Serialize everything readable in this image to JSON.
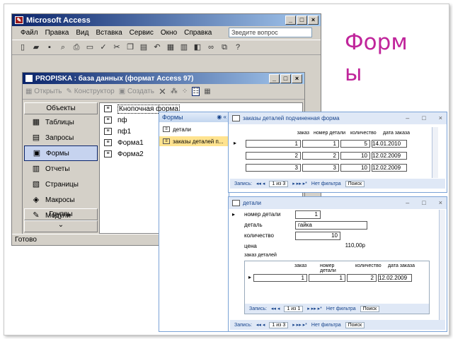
{
  "slide": {
    "title": "Формы"
  },
  "access": {
    "title": "Microsoft Access",
    "menu": [
      "Файл",
      "Правка",
      "Вид",
      "Вставка",
      "Сервис",
      "Окно",
      "Справка"
    ],
    "ask_placeholder": "Зведите вопрос",
    "status": "Готово"
  },
  "dbwin": {
    "title": "PROPISKA : база данных (формат Access 97)",
    "toolbar": {
      "open": "Открыть",
      "design": "Конструктор",
      "create": "Создать"
    },
    "objects_header": "Объекты",
    "objects": [
      {
        "icon": "▦",
        "label": "Таблицы",
        "selected": false
      },
      {
        "icon": "▤",
        "label": "Запросы",
        "selected": false
      },
      {
        "icon": "▣",
        "label": "Формы",
        "selected": true
      },
      {
        "icon": "▥",
        "label": "Отчеты",
        "selected": false
      },
      {
        "icon": "▧",
        "label": "Страницы",
        "selected": false
      },
      {
        "icon": "◈",
        "label": "Макросы",
        "selected": false
      },
      {
        "icon": "✎",
        "label": "Модули",
        "selected": false
      }
    ],
    "groups": "Группы",
    "forms": [
      "Кнопочная форма",
      "пф",
      "пф1",
      "Форма1",
      "Форма2"
    ]
  },
  "nav": {
    "header": "Формы",
    "items": [
      "детали",
      "заказы деталей п..."
    ]
  },
  "form1": {
    "title": "заказы деталей подчиненная форма",
    "columns": [
      "заказ",
      "номер детали",
      "количество",
      "дата заказа"
    ],
    "rows": [
      [
        "1",
        "1",
        "5",
        "14.01.2010"
      ],
      [
        "2",
        "2",
        "10",
        "12.02.2009"
      ],
      [
        "3",
        "3",
        "10",
        "12.02.2009"
      ]
    ],
    "nav": {
      "label": "Запись:",
      "pos": "1 из 3",
      "filter": "Нет фильтра",
      "search": "Поиск"
    }
  },
  "form2": {
    "title": "детали",
    "fields": [
      {
        "label": "номер детали",
        "value": "1"
      },
      {
        "label": "деталь",
        "value": "гайка"
      },
      {
        "label": "количество",
        "value": "10"
      },
      {
        "label": "цена",
        "value": "110,00р"
      }
    ],
    "subform_label": "заказ деталей",
    "sub_columns": [
      "заказ",
      "номер детали",
      "количество",
      "дата заказа"
    ],
    "sub_row": [
      "1",
      "1",
      "2",
      "12.02.2009"
    ],
    "sub_nav": {
      "label": "Запись:",
      "pos": "1 из 1",
      "filter": "Нет фильтра",
      "search": "Поиск"
    },
    "nav": {
      "label": "Запись:",
      "pos": "1 из 3",
      "filter": "Нет фильтра",
      "search": "Поиск"
    }
  }
}
